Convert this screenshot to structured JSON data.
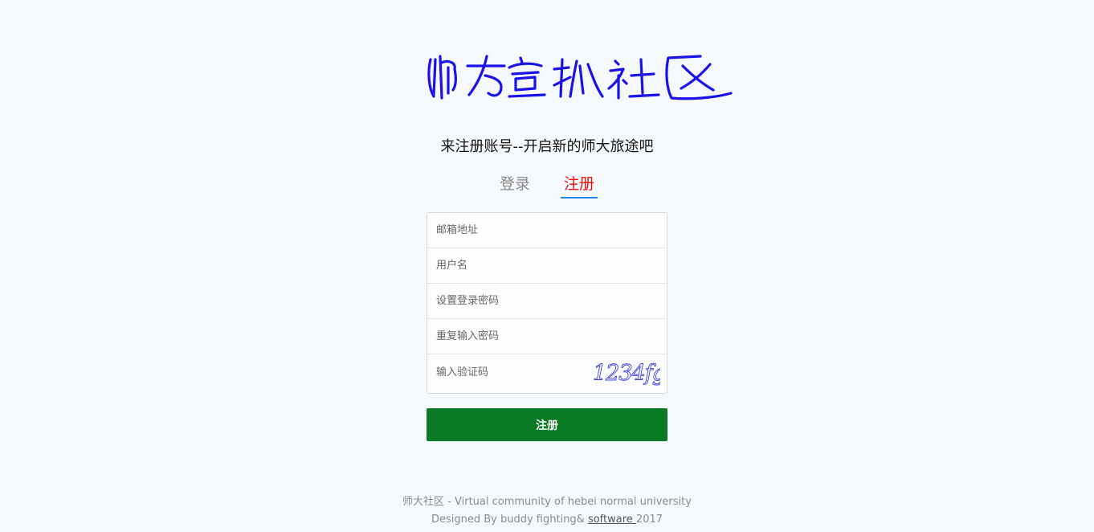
{
  "logo": {
    "text": "师大宣抓社区",
    "color": "#1a12e8"
  },
  "subtitle": "来注册账号--开启新的师大旅途吧",
  "tabs": {
    "login": "登录",
    "register": "注册",
    "active": "register"
  },
  "form": {
    "email_placeholder": "邮箱地址",
    "username_placeholder": "用户名",
    "password_placeholder": "设置登录密码",
    "repeat_password_placeholder": "重复输入密码",
    "captcha_placeholder": "输入验证码",
    "captcha_text": "1234fg"
  },
  "submit_label": "注册",
  "colors": {
    "submit_bg": "#0b7a25",
    "active_tab": "#e8100f",
    "tab_underline": "#1e88e5",
    "page_bg": "#f6f9fc"
  },
  "footer": {
    "line1": "师大社区 - Virtual community of hebei normal university",
    "line2_prefix": "Designed By buddy fighting& ",
    "line2_link": "software ",
    "line2_suffix": "2017"
  }
}
